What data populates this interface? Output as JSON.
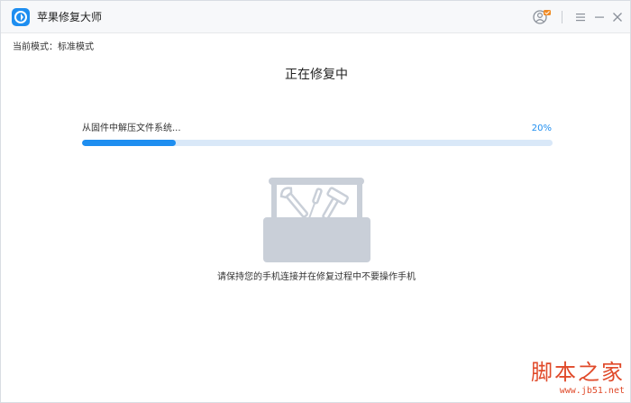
{
  "window": {
    "title": "苹果修复大师"
  },
  "titlebar": {
    "icons": [
      "app-logo-icon",
      "user-account-icon",
      "menu-icon",
      "minimize-icon",
      "close-icon"
    ]
  },
  "mode": {
    "text": "当前模式：标准模式"
  },
  "main": {
    "title": "正在修复中",
    "progress": {
      "label": "从固件中解压文件系统...",
      "percent_text": "20%",
      "value": 0.2
    },
    "illustration": "toolbox-icon",
    "notice": "请保持您的手机连接并在修复过程中不要操作手机"
  },
  "watermark": {
    "main": "脚本之家",
    "sub": "www.jb51.net"
  },
  "colors": {
    "accent": "#1e8ef0",
    "track": "#d9e8f8",
    "toolbox": "#c9cfd8",
    "watermark": "#e04a2a"
  }
}
